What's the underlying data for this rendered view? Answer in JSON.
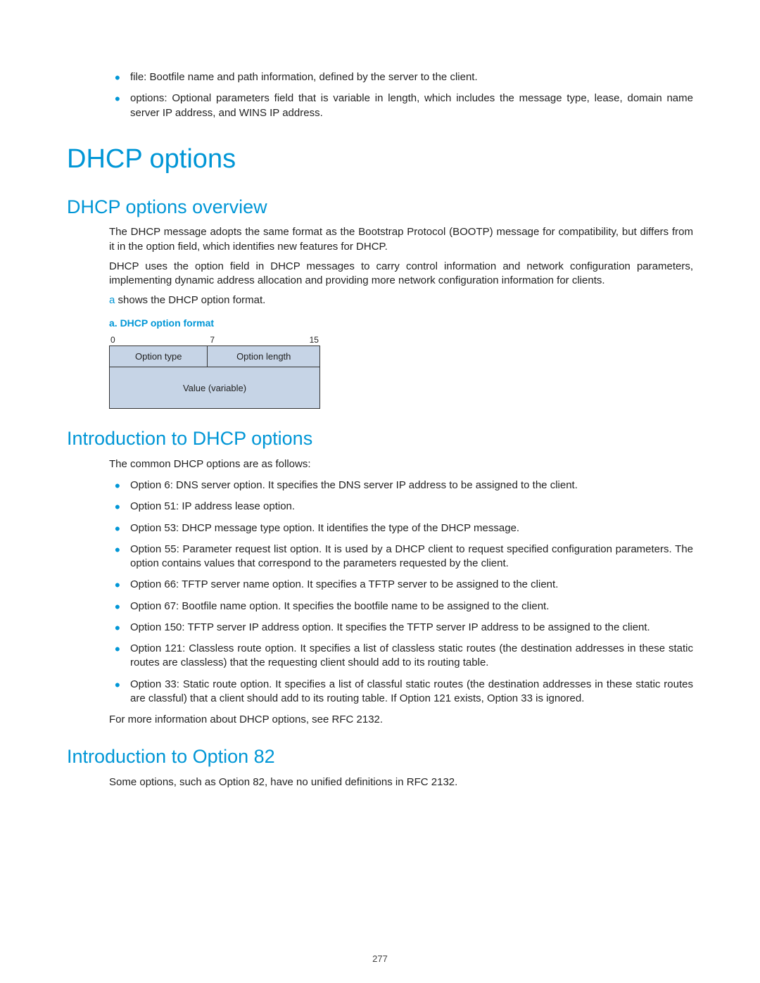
{
  "top_bullets": [
    "file: Bootfile name and path information, defined by the server to the client.",
    "options: Optional parameters field that is variable in length, which includes the message type, lease, domain name server IP address, and WINS IP address."
  ],
  "h1": "DHCP options",
  "sec1": {
    "title": "DHCP options overview",
    "p1": "The DHCP message adopts the same format as the Bootstrap Protocol (BOOTP) message for compatibility, but differs from it in the option field, which identifies new features for DHCP.",
    "p2": "DHCP uses the option field in DHCP messages to carry control information and network configuration parameters, implementing dynamic address allocation and providing more network configuration information for clients.",
    "p3_a": "a",
    "p3_rest": " shows the DHCP option format.",
    "caption": "a.   DHCP option format",
    "diagram": {
      "n0": "0",
      "n7": "7",
      "n15": "15",
      "cell1": "Option type",
      "cell2": "Option length",
      "cell3": "Value (variable)"
    }
  },
  "sec2": {
    "title": "Introduction to DHCP options",
    "lead": "The common DHCP options are as follows:",
    "items": [
      "Option 6: DNS server option. It specifies the DNS server IP address to be assigned to the client.",
      "Option 51: IP address lease option.",
      "Option 53: DHCP message type option. It identifies the type of the DHCP message.",
      "Option 55: Parameter request list option. It is used by a DHCP client to request specified configuration parameters. The option contains values that correspond to the parameters requested by the client.",
      "Option 66: TFTP server name option. It specifies a TFTP server to be assigned to the client.",
      "Option 67: Bootfile name option. It specifies the bootfile name to be assigned to the client.",
      "Option 150: TFTP server IP address option. It specifies the TFTP server IP address to be assigned to the client.",
      "Option 121: Classless route option. It specifies a list of classless static routes (the destination addresses in these static routes are classless) that the requesting client should add to its routing table.",
      "Option 33: Static route option. It specifies a list of classful static routes (the destination addresses in these static routes are classful) that a client should add to its routing table. If Option 121 exists, Option 33 is ignored."
    ],
    "after": "For more information about DHCP options, see RFC 2132."
  },
  "sec3": {
    "title": "Introduction to Option 82",
    "p1": "Some options, such as Option 82, have no unified definitions in RFC 2132."
  },
  "page_number": "277"
}
